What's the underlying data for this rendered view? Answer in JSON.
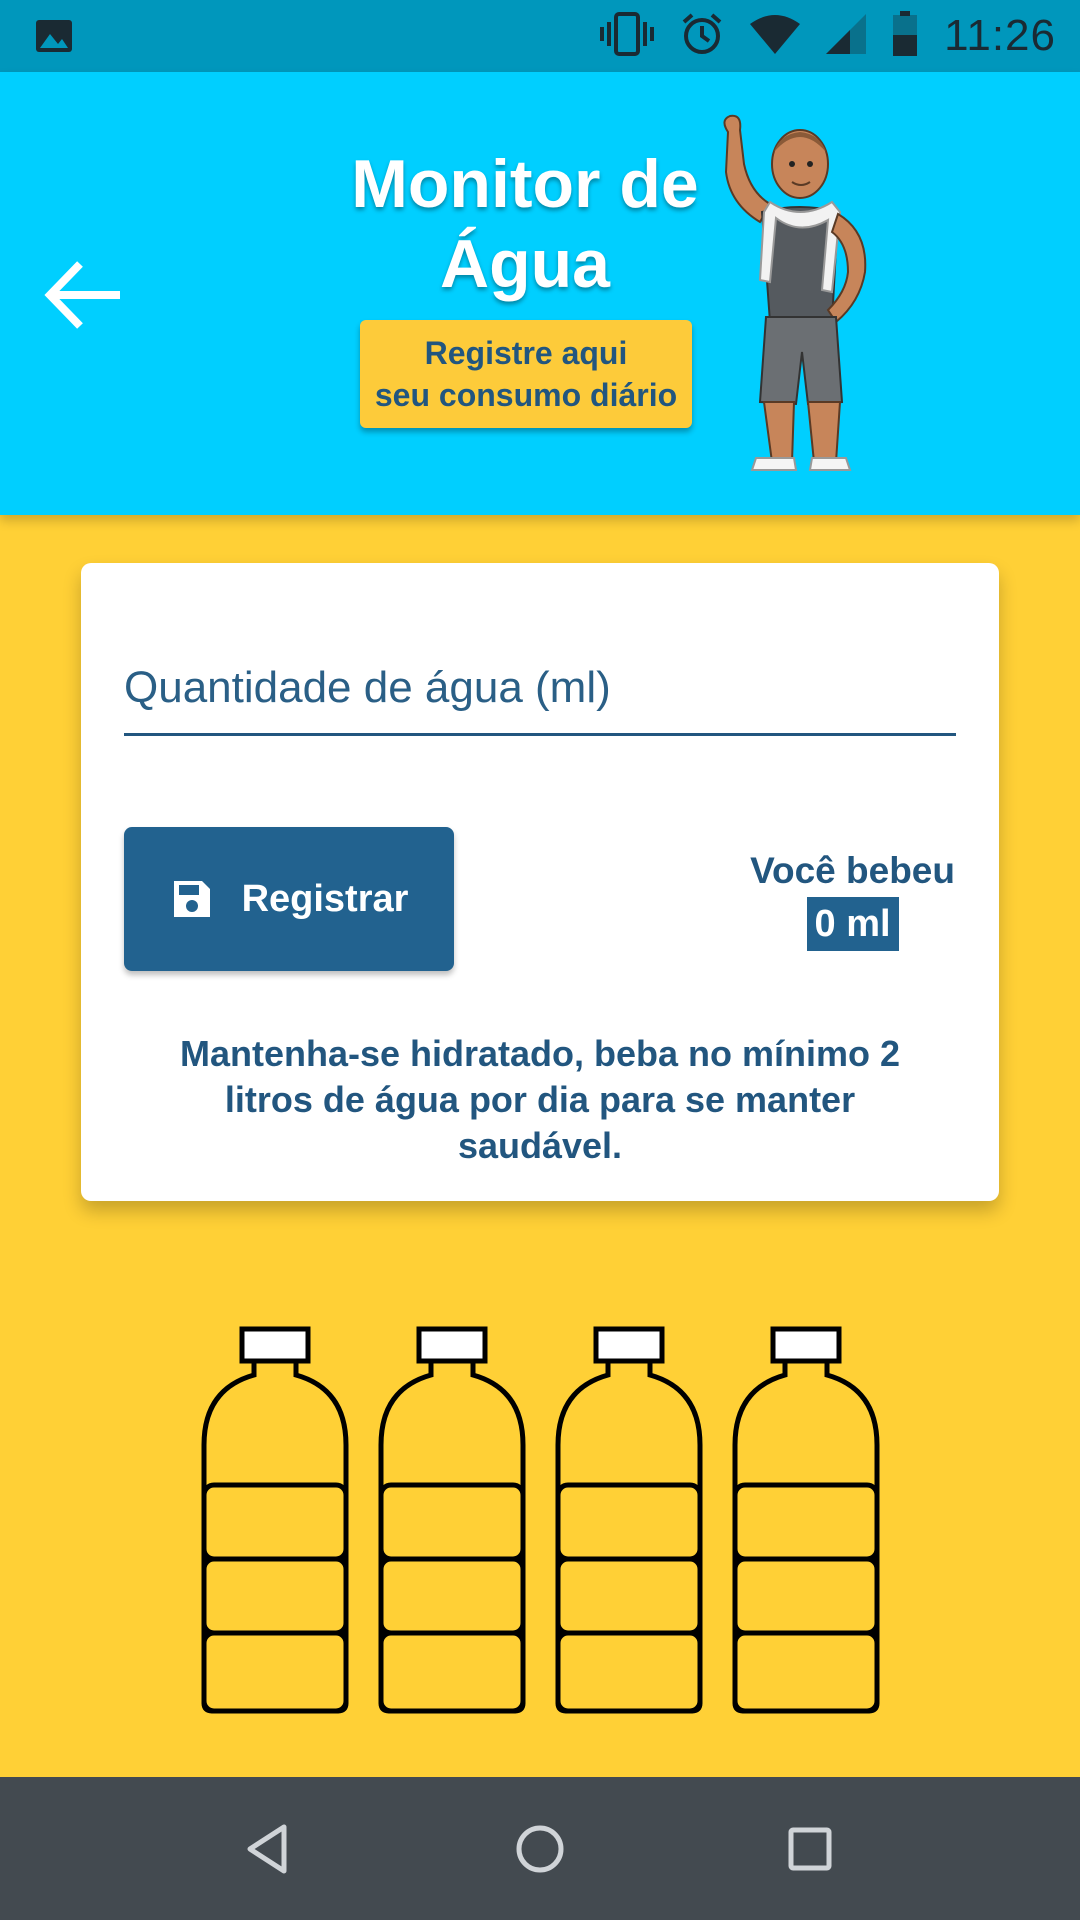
{
  "status_bar": {
    "time": "11:26"
  },
  "header": {
    "title_line1": "Monitor de",
    "title_line2": "Água",
    "subtitle_line1": "Registre aqui",
    "subtitle_line2": "seu consumo diário"
  },
  "form": {
    "input_placeholder": "Quantidade de água (ml)",
    "input_value": "",
    "register_label": "Registrar",
    "drank_label": "Você bebeu",
    "drank_value": "0 ml",
    "tip": "Mantenha-se hidratado, beba no mínimo 2 litros de água por dia para se manter saudável."
  },
  "bottles": {
    "count": 4,
    "filled": 0
  },
  "colors": {
    "header_bg": "#00CFFF",
    "page_bg": "#FFD036",
    "primary": "#22628F",
    "status_bar": "#0097BC",
    "nav_bar": "#434A50"
  },
  "icons": [
    "image-icon",
    "vibrate-icon",
    "alarm-icon",
    "wifi-icon",
    "signal-icon",
    "battery-icon",
    "back-arrow-icon",
    "save-icon",
    "nav-back-icon",
    "nav-home-icon",
    "nav-recents-icon"
  ]
}
